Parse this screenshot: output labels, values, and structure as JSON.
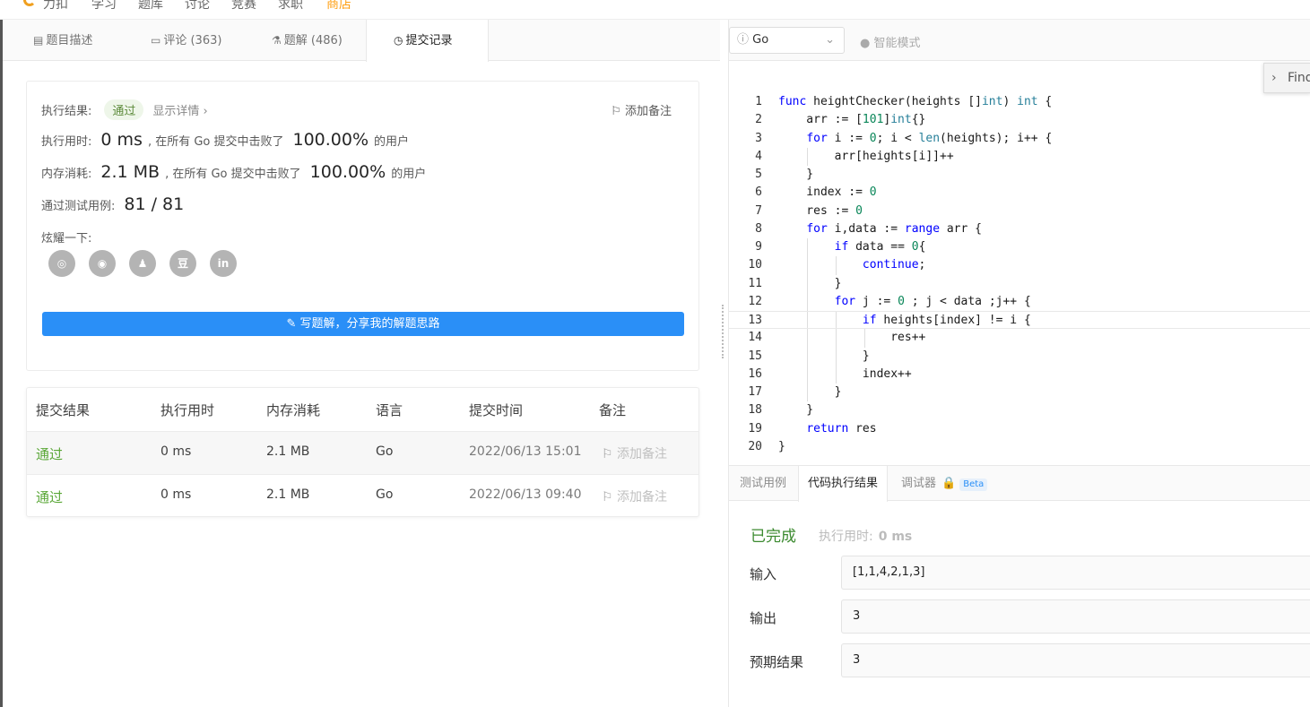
{
  "topnav": {
    "logo": "力扣",
    "items": [
      "学习",
      "题库",
      "讨论",
      "竞赛",
      "求职",
      "商店"
    ]
  },
  "left_tabs": [
    {
      "label": "题目描述",
      "icon": "description-icon"
    },
    {
      "label": "评论 (363)",
      "icon": "comment-icon"
    },
    {
      "label": "题解 (486)",
      "icon": "flask-icon"
    },
    {
      "label": "提交记录",
      "icon": "clock-icon"
    }
  ],
  "result": {
    "label_result": "执行结果:",
    "status": "通过",
    "detail": "显示详情 ›",
    "add_note": "添加备注",
    "label_time": "执行用时:",
    "time": "0 ms",
    "time_mid": ", 在所有 Go 提交中击败了",
    "time_pct": "100.00%",
    "users": "的用户",
    "label_mem": "内存消耗:",
    "mem": "2.1 MB",
    "mem_mid": ", 在所有 Go 提交中击败了",
    "mem_pct": "100.00%",
    "label_cases": "通过测试用例:",
    "cases": "81 / 81",
    "share_label": "炫耀一下:",
    "share_icons": [
      "wechat-icon",
      "weibo-icon",
      "qq-icon",
      "douban-icon",
      "linkedin-icon"
    ],
    "write_btn": "写题解，分享我的解题思路"
  },
  "submissions": {
    "headers": [
      "提交结果",
      "执行用时",
      "内存消耗",
      "语言",
      "提交时间",
      "备注"
    ],
    "rows": [
      {
        "status": "通过",
        "time": "0 ms",
        "mem": "2.1 MB",
        "lang": "Go",
        "when": "2022/06/13 15:01",
        "note": "添加备注"
      },
      {
        "status": "通过",
        "time": "0 ms",
        "mem": "2.1 MB",
        "lang": "Go",
        "when": "2022/06/13 09:40",
        "note": "添加备注"
      }
    ]
  },
  "editor": {
    "language": "Go",
    "smart_mode": "智能模式",
    "find": "Find",
    "lines": [
      "func heightChecker(heights []int) int {",
      "    arr := [101]int{}",
      "    for i := 0; i < len(heights); i++ {",
      "        arr[heights[i]]++",
      "    }",
      "    index := 0",
      "    res := 0",
      "    for i,data := range arr {",
      "        if data == 0{",
      "            continue;",
      "        }",
      "        for j := 0 ; j < data ;j++ {",
      "            if heights[index] != i {",
      "                res++",
      "            }",
      "            index++",
      "        }",
      "    }",
      "    return res",
      "}"
    ]
  },
  "console": {
    "tabs": [
      "测试用例",
      "代码执行结果",
      "调试器",
      "Beta"
    ],
    "status": "已完成",
    "exec_label": "执行用时:",
    "exec_time": "0 ms",
    "input_label": "输入",
    "input": "[1,1,4,2,1,3]",
    "output_label": "输出",
    "output": "3",
    "expected_label": "预期结果",
    "expected": "3"
  }
}
